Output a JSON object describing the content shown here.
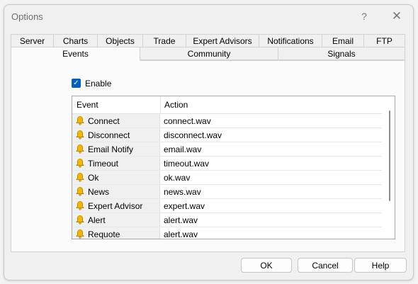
{
  "window": {
    "title": "Options"
  },
  "titlebar": {
    "help_glyph": "?",
    "close_glyph": "✕"
  },
  "tabs_row1": [
    "Server",
    "Charts",
    "Objects",
    "Trade",
    "Expert Advisors",
    "Notifications",
    "Email",
    "FTP"
  ],
  "tabs_row2": [
    "Events",
    "Community",
    "Signals"
  ],
  "active_tab": "Events",
  "events_panel": {
    "enable_label": "Enable",
    "enable_checked": true,
    "table": {
      "columns": [
        "Event",
        "Action"
      ],
      "rows": [
        {
          "event": "Connect",
          "action": "connect.wav"
        },
        {
          "event": "Disconnect",
          "action": "disconnect.wav"
        },
        {
          "event": "Email Notify",
          "action": "email.wav"
        },
        {
          "event": "Timeout",
          "action": "timeout.wav"
        },
        {
          "event": "Ok",
          "action": "ok.wav"
        },
        {
          "event": "News",
          "action": "news.wav"
        },
        {
          "event": "Expert Advisor",
          "action": "expert.wav"
        },
        {
          "event": "Alert",
          "action": "alert.wav"
        },
        {
          "event": "Requote",
          "action": "alert.wav"
        }
      ]
    }
  },
  "buttons": {
    "ok": "OK",
    "cancel": "Cancel",
    "help": "Help"
  },
  "colors": {
    "accent": "#005fb8",
    "bell": "#f2b705",
    "bell_outline": "#b07c00"
  },
  "icons": {
    "row_icon": "bell-icon",
    "checkbox_mark": "✓"
  }
}
